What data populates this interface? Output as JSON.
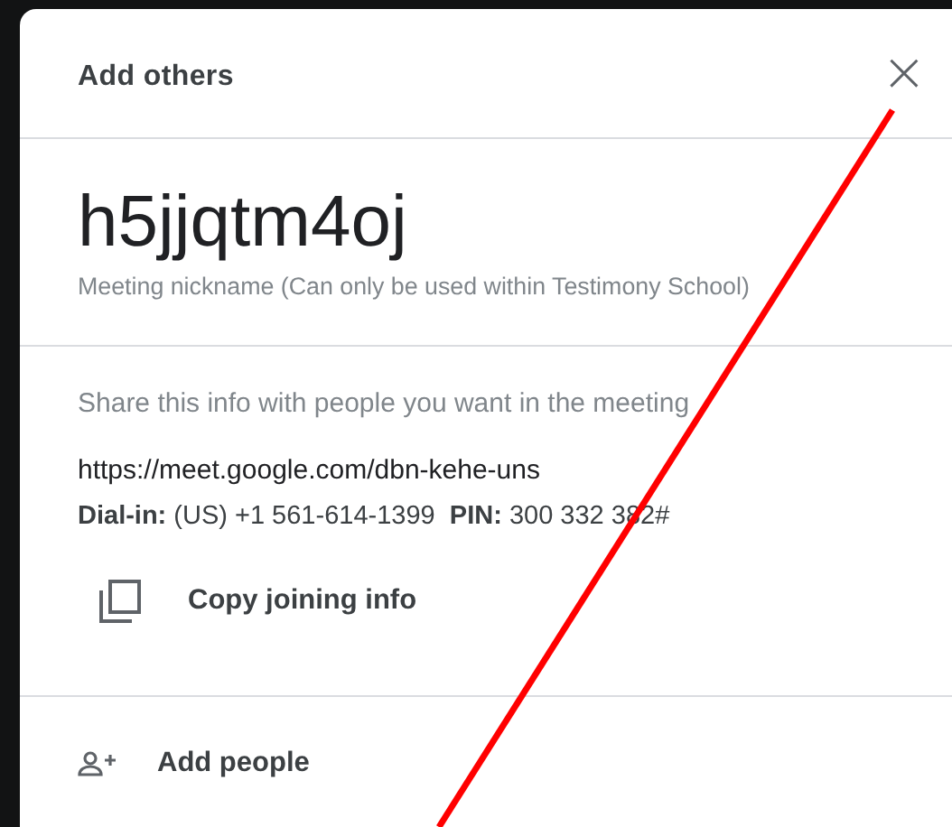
{
  "dialog": {
    "title": "Add others",
    "close_icon": "×"
  },
  "meeting": {
    "nickname": "h5jjqtm4oj",
    "caption": "Meeting nickname (Can only be used within Testimony School)"
  },
  "share": {
    "hint": "Share this info with people you want in the meeting",
    "url": "https://meet.google.com/dbn-kehe-uns",
    "dial_in": "**Dial-in:** (US) +1 561-614-1399  **PIN:** 300 332 382#",
    "copy_label": "Copy joining info"
  },
  "add_people": {
    "label": "Add people"
  }
}
